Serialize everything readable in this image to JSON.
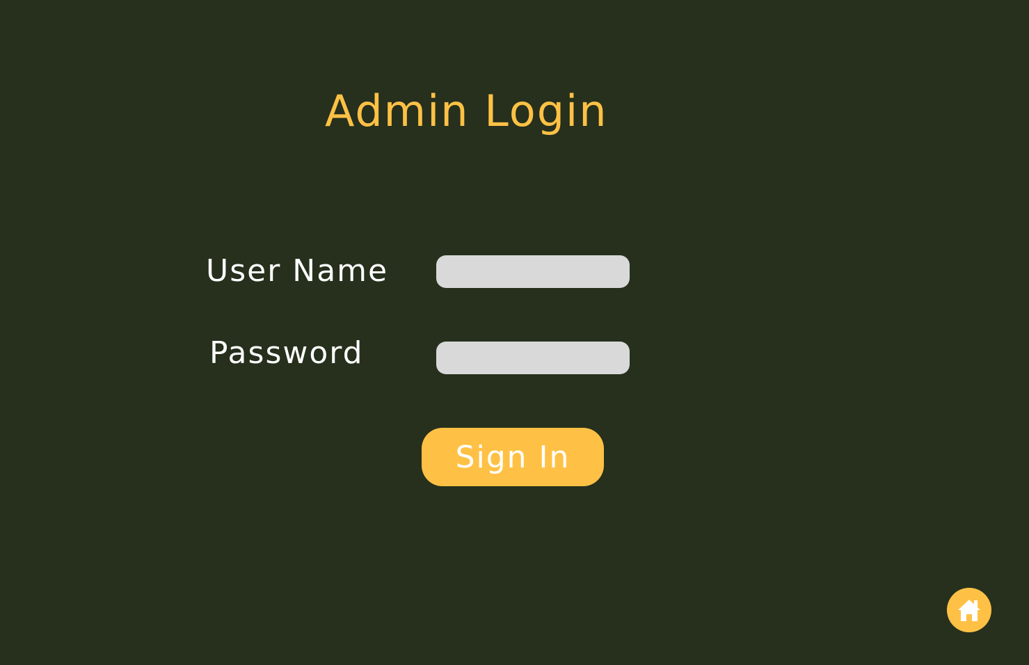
{
  "page": {
    "title": "Admin Login",
    "background_color": "#26301d",
    "accent_color": "#ffc145"
  },
  "form": {
    "username_label": "User Name",
    "username_value": "",
    "password_label": "Password",
    "password_value": "",
    "submit_label": "Sign In"
  },
  "home_button": {
    "icon": "home-icon"
  }
}
